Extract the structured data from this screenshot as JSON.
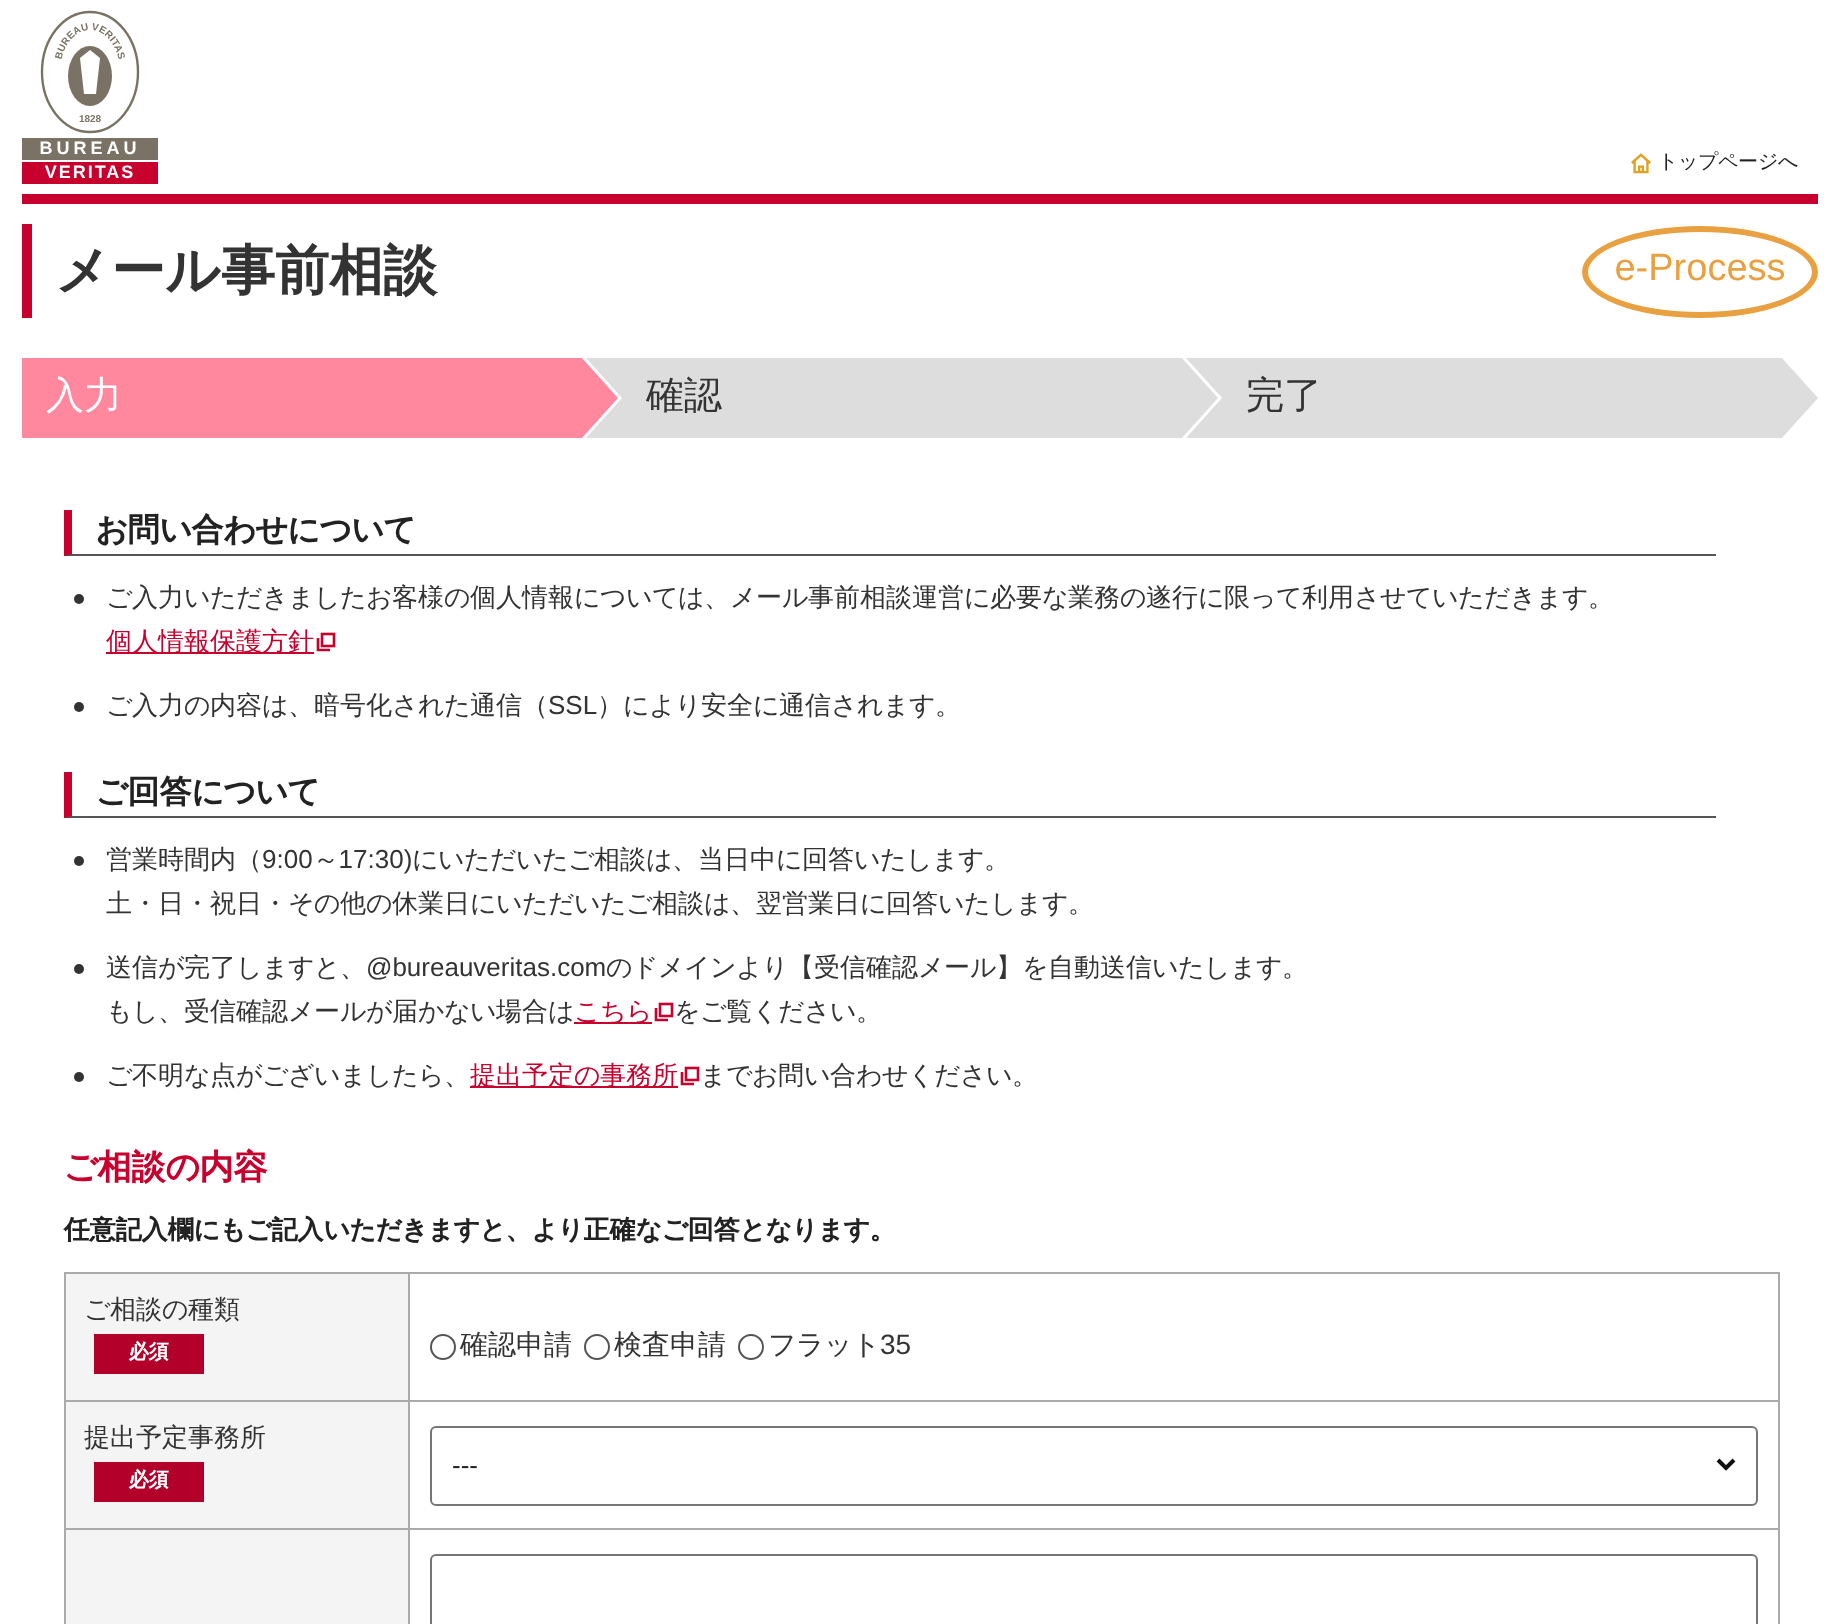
{
  "logo": {
    "arc_text": "BUREAU VERITAS",
    "year": "1828",
    "line1": "BUREAU",
    "line2": "VERITAS"
  },
  "top_link": "トップページへ",
  "page_title": "メール事前相談",
  "badge": "e-Process",
  "steps": [
    {
      "label": "入力",
      "selected": true
    },
    {
      "label": "確認",
      "selected": false
    },
    {
      "label": "完了",
      "selected": false
    }
  ],
  "sections": [
    {
      "heading": "お問い合わせについて",
      "items": [
        {
          "lines": [
            {
              "parts": [
                {
                  "text": "ご入力いただきましたお客様の個人情報については、メール事前相談運営に必要な業務の遂行に限って利用させていただきます。",
                  "kind": "text"
                }
              ]
            },
            {
              "parts": [
                {
                  "text": "個人情報保護方針",
                  "kind": "link"
                }
              ]
            }
          ]
        },
        {
          "lines": [
            {
              "parts": [
                {
                  "text": "ご入力の内容は、暗号化された通信（SSL）により安全に通信されます。",
                  "kind": "text"
                }
              ]
            }
          ]
        }
      ]
    },
    {
      "heading": "ご回答について",
      "items": [
        {
          "lines": [
            {
              "parts": [
                {
                  "text": "営業時間内（9:00～17:30)にいただいたご相談は、当日中に回答いたします。",
                  "kind": "text"
                }
              ]
            },
            {
              "parts": [
                {
                  "text": "土・日・祝日・その他の休業日にいただいたご相談は、翌営業日に回答いたします。",
                  "kind": "text"
                }
              ]
            }
          ]
        },
        {
          "lines": [
            {
              "parts": [
                {
                  "text": "送信が完了しますと、@bureauveritas.comのドメインより【受信確認メール】を自動送信いたします。",
                  "kind": "text"
                }
              ]
            },
            {
              "parts": [
                {
                  "text": "もし、受信確認メールが届かない場合は",
                  "kind": "text"
                },
                {
                  "text": "こちら",
                  "kind": "link"
                },
                {
                  "text": "をご覧ください。",
                  "kind": "text"
                }
              ]
            }
          ]
        },
        {
          "lines": [
            {
              "parts": [
                {
                  "text": "ご不明な点がございましたら、",
                  "kind": "text"
                },
                {
                  "text": "提出予定の事務所",
                  "kind": "link"
                },
                {
                  "text": "までお問い合わせください。",
                  "kind": "text"
                }
              ]
            }
          ]
        }
      ]
    }
  ],
  "form": {
    "heading": "ご相談の内容",
    "note": "任意記入欄にもご記入いただきますと、より正確なご回答となります。",
    "rows": [
      {
        "kind": "radio",
        "label": "ご相談の種類",
        "required": "必須",
        "options": [
          {
            "label": "確認申請",
            "selected": false
          },
          {
            "label": "検査申請",
            "selected": false
          },
          {
            "label": "フラット35",
            "selected": false
          }
        ]
      },
      {
        "kind": "select",
        "label": "提出予定事務所",
        "required": "必須",
        "value": "---"
      },
      {
        "kind": "text"
      }
    ]
  }
}
